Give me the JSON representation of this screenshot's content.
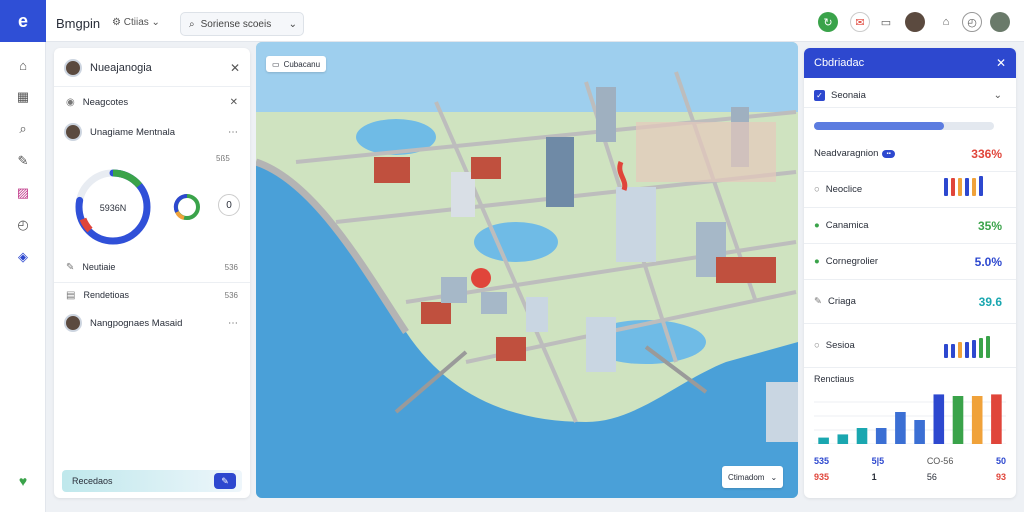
{
  "app": {
    "logo": "e",
    "name": "Bmgpin",
    "workspace": "Ctiias"
  },
  "search": {
    "placeholder": "Soriense scoeis"
  },
  "topbar": {
    "icons": [
      "refresh-icon",
      "mail-icon",
      "calendar-icon",
      "avatar",
      "home-icon",
      "clock-icon",
      "avatar"
    ]
  },
  "colors": {
    "accent": "#2d48cf",
    "green": "#3aa34a",
    "red": "#e0453a",
    "orange": "#f0a23a",
    "teal": "#1aa7b0"
  },
  "left_panel": {
    "title": "Nueajanogia",
    "menu1": "Neagcotes",
    "user1": "Unagiame Mentnala",
    "stat_small": "5ß5",
    "donut_label": "5936N",
    "donut_fraction": 0.78,
    "ring_label": "0",
    "item1_label": "Neutiaie",
    "item1_value": "536",
    "item2_label": "Rendetioas",
    "item2_value": "536",
    "user2": "Nangpognaes Masaid",
    "footer_label": "Recedaos"
  },
  "map": {
    "chip_label": "Cubacanu",
    "bottom_chip_label": "Ctimadom"
  },
  "right_panel": {
    "title": "Cbdriadac",
    "checkbox_label": "Seonaia",
    "progress": 0.72,
    "header_row_label": "Neadvaragnion",
    "header_row_value": "336%",
    "rows": [
      {
        "label": "Neoclice",
        "value": "",
        "color": "#555"
      },
      {
        "label": "Canamica",
        "value": "35%",
        "color": "#3aa34a"
      },
      {
        "label": "Cornegrolier",
        "value": "5.0%",
        "color": "#2d48cf"
      },
      {
        "label": "Criaga",
        "value": "39.6",
        "color": "#1aa7b0"
      },
      {
        "label": "Sesioa",
        "value": "",
        "color": "#555"
      }
    ],
    "chart_title": "Renctiaus"
  },
  "chart_data": {
    "type": "bar",
    "title": "Renctiaus",
    "values": [
      8,
      12,
      20,
      20,
      40,
      30,
      62,
      60,
      60,
      62
    ],
    "colors": [
      "#1aa7b0",
      "#1aa7b0",
      "#1aa7b0",
      "#3b6fd4",
      "#3b6fd4",
      "#3b6fd4",
      "#2d48cf",
      "#3aa34a",
      "#f0a23a",
      "#e0453a"
    ],
    "ylim": [
      0,
      70
    ],
    "footer": [
      [
        "535",
        "935"
      ],
      [
        "5|5",
        "1"
      ],
      [
        "CO-56",
        "56"
      ],
      [
        "50",
        "93"
      ]
    ]
  }
}
